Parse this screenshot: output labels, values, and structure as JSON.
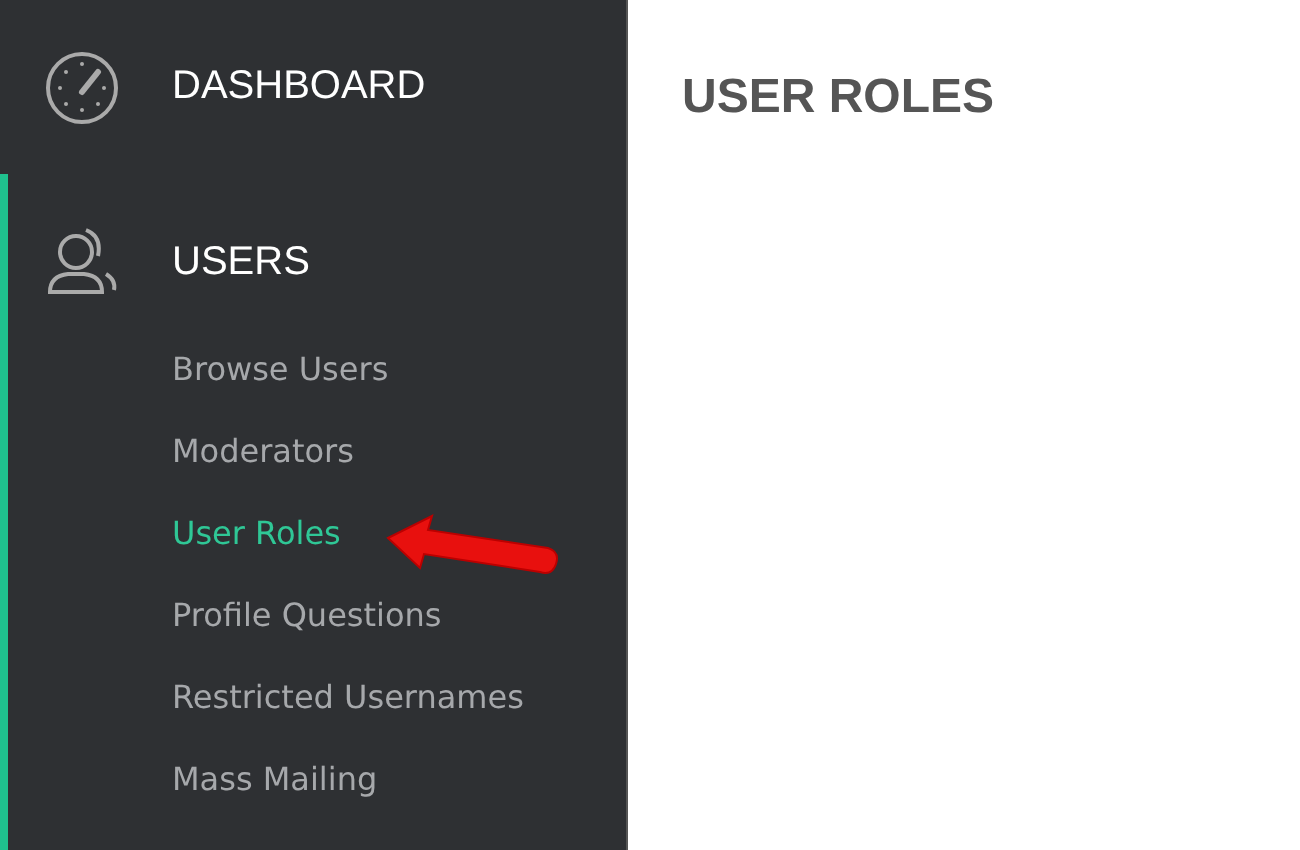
{
  "sidebar": {
    "sections": [
      {
        "label": "DASHBOARD",
        "kind": "dashboard",
        "selected": false
      },
      {
        "label": "USERS",
        "kind": "users",
        "selected": true,
        "children": [
          {
            "label": "Browse Users",
            "selected": false
          },
          {
            "label": "Moderators",
            "selected": false
          },
          {
            "label": "User Roles",
            "selected": true
          },
          {
            "label": "Profile Questions",
            "selected": false
          },
          {
            "label": "Restricted Usernames",
            "selected": false
          },
          {
            "label": "Mass Mailing",
            "selected": false
          }
        ]
      }
    ]
  },
  "page": {
    "title": "USER ROLES"
  }
}
